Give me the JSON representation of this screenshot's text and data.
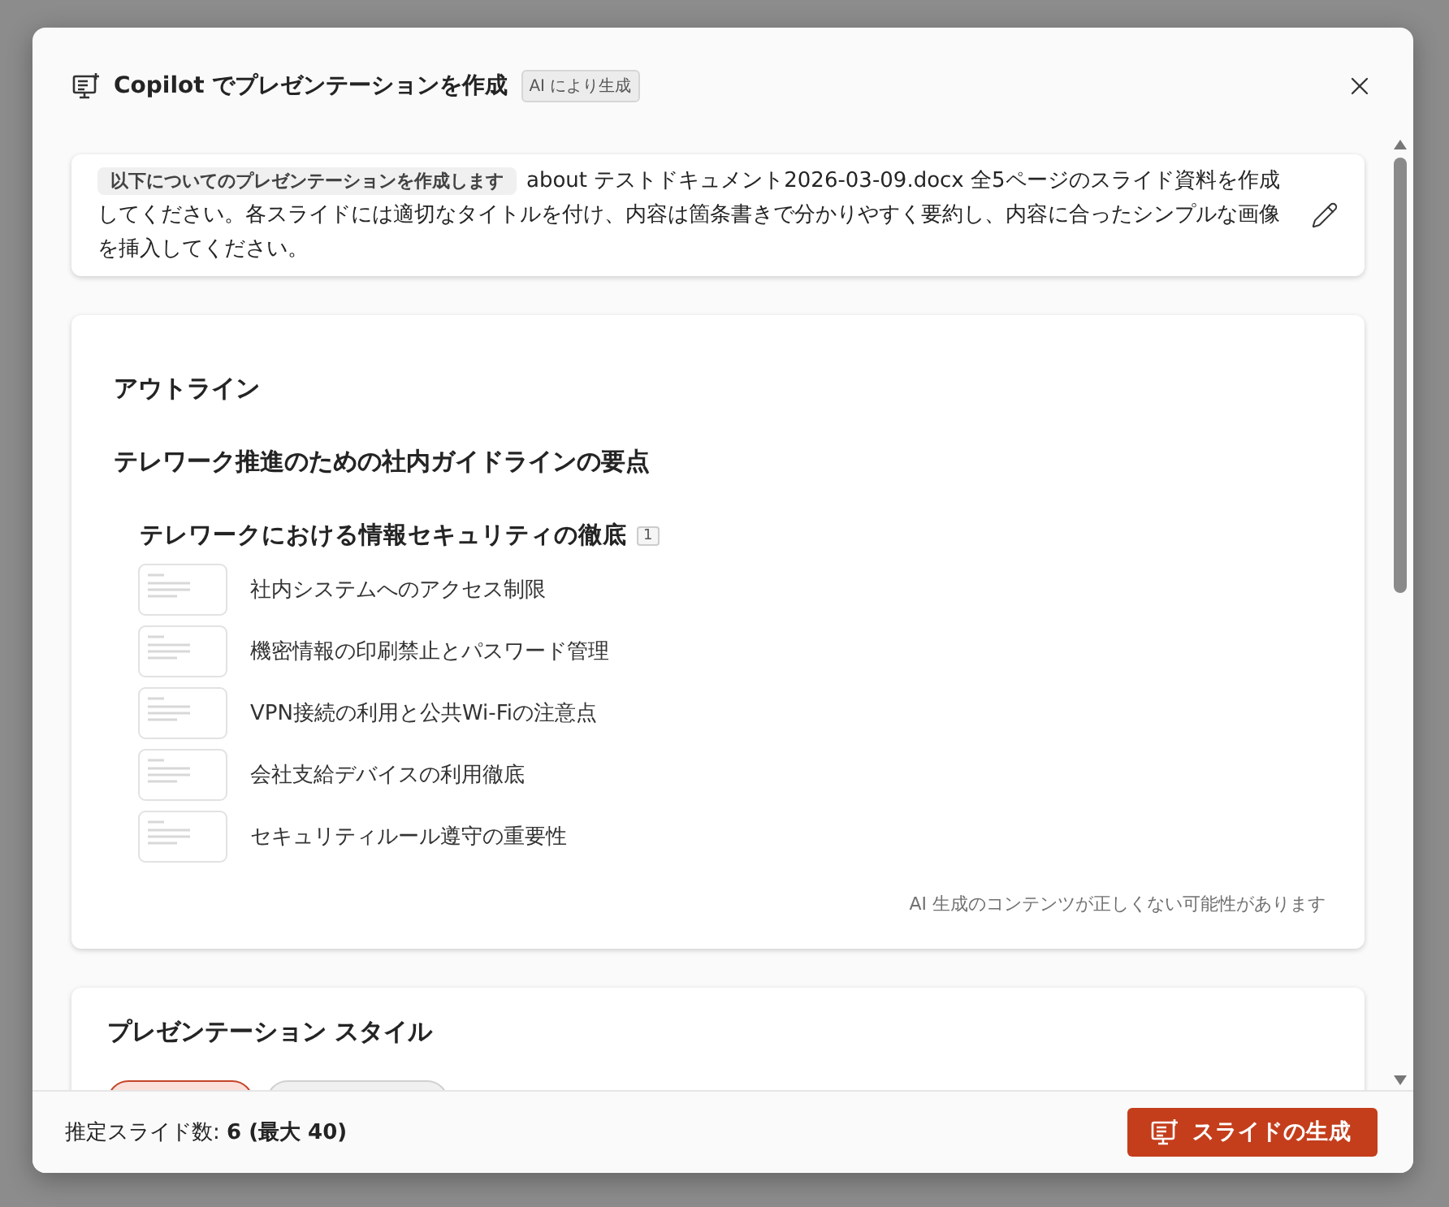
{
  "dialog": {
    "title": "Copilot でプレゼンテーションを作成",
    "badge": "AI により生成"
  },
  "prompt": {
    "label": "以下についてのプレゼンテーションを作成します",
    "text": "about テストドキュメント2026-03-09.docx 全5ページのスライド資料を作成してください。各スライドには適切なタイトルを付け、内容は箇条書きで分かりやすく要約し、内容に合ったシンプルな画像を挿入してください。"
  },
  "outline": {
    "heading": "アウトライン",
    "title": "テレワーク推進のための社内ガイドラインの要点",
    "sections": [
      {
        "title": "テレワークにおける情報セキュリティの徹底",
        "citation": "1",
        "items": [
          "社内システムへのアクセス制限",
          "機密情報の印刷禁止とパスワード管理",
          "VPN接続の利用と公共Wi-Fiの注意点",
          "会社支給デバイスの利用徹底",
          "セキュリティルール遵守の重要性"
        ]
      }
    ],
    "disclaimer": "AI 生成のコンテンツが正しくない可能性があります"
  },
  "style": {
    "heading": "プレゼンテーション スタイル",
    "options": [
      {
        "selected": true
      },
      {
        "selected": false
      }
    ]
  },
  "footer": {
    "estimate": "推定スライド数: **6 (最大 40)**",
    "generate_button": "スライドの生成"
  }
}
